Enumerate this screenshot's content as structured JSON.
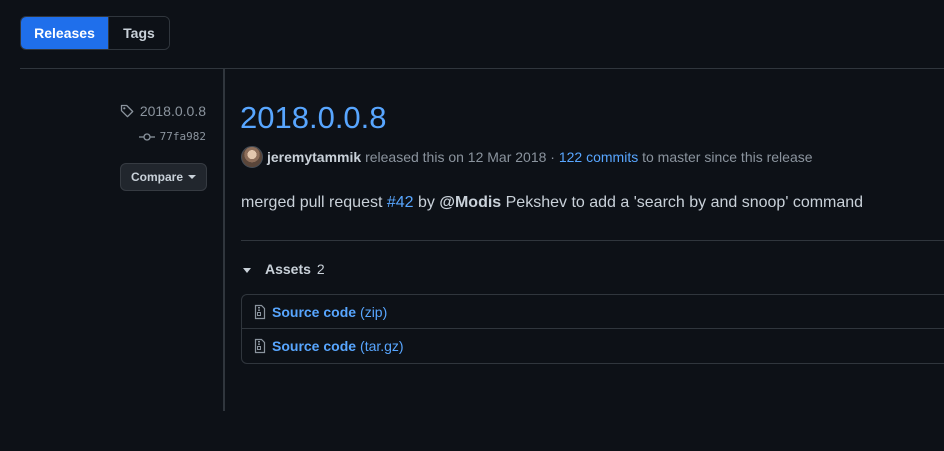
{
  "tabs": [
    {
      "label": "Releases",
      "active": true
    },
    {
      "label": "Tags",
      "active": false
    }
  ],
  "sidebar": {
    "tag": "2018.0.0.8",
    "commit": "77fa982",
    "compare_label": "Compare"
  },
  "release": {
    "title": "2018.0.0.8",
    "author": "jeremytammik",
    "released_text": "released this on 12 Mar 2018",
    "separator": " · ",
    "commits_link": "122 commits",
    "commits_suffix": "to master since this release",
    "body": {
      "prefix": "merged pull request ",
      "pr_link": "#42",
      "by": " by ",
      "mention": "@Modis",
      "suffix": " Pekshev to add a 'search by and snoop' command"
    }
  },
  "assets": {
    "label": "Assets",
    "count": "2",
    "items": [
      {
        "name": "Source code",
        "ext": "(zip)"
      },
      {
        "name": "Source code",
        "ext": "(tar.gz)"
      }
    ]
  },
  "colors": {
    "background": "#0d1117",
    "accent_blue": "#58a6ff",
    "active_tab": "#1f6feb",
    "border": "#30363d",
    "muted": "#8b949e"
  }
}
